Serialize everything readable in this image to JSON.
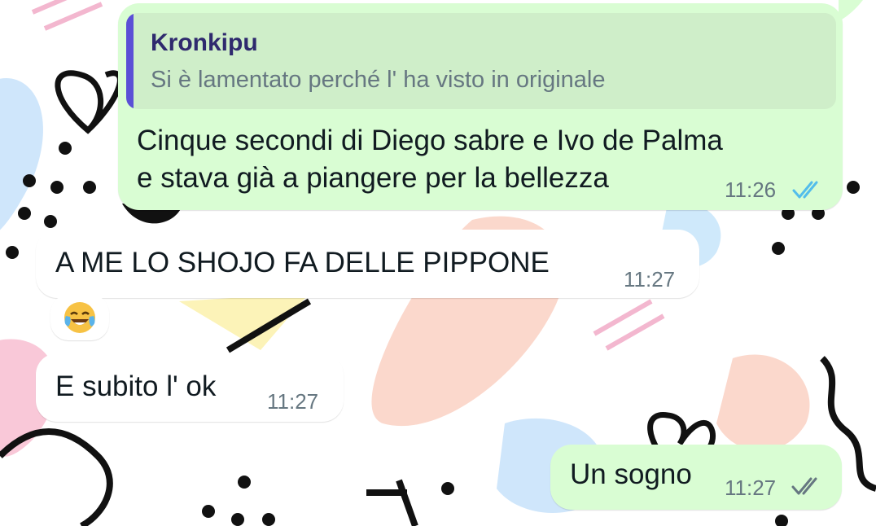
{
  "colors": {
    "outgoing_bubble": "#d9fdd3",
    "incoming_bubble": "#ffffff",
    "quote_bar": "#5b4fd6",
    "read_ticks": "#53bdeb",
    "delivered_ticks": "#667781"
  },
  "messages": [
    {
      "direction": "outgoing",
      "reply": {
        "author": "Kronkipu",
        "text": "Si è lamentato perché l' ha visto in originale"
      },
      "line1": "Cinque secondi di Diego sabre e Ivo de Palma",
      "line2": "e stava già a piangere per la bellezza",
      "time": "11:26",
      "status_icon": "double-check-read-icon"
    },
    {
      "direction": "incoming",
      "text": "A  ME LO SHOJO FA DELLE PIPPONE",
      "time": "11:27",
      "reaction": "face-with-tears-of-joy-emoji"
    },
    {
      "direction": "incoming",
      "text": "E subito l' ok",
      "time": "11:27"
    },
    {
      "direction": "outgoing",
      "text": "Un sogno",
      "time": "11:27",
      "status_icon": "double-check-delivered-icon"
    }
  ]
}
